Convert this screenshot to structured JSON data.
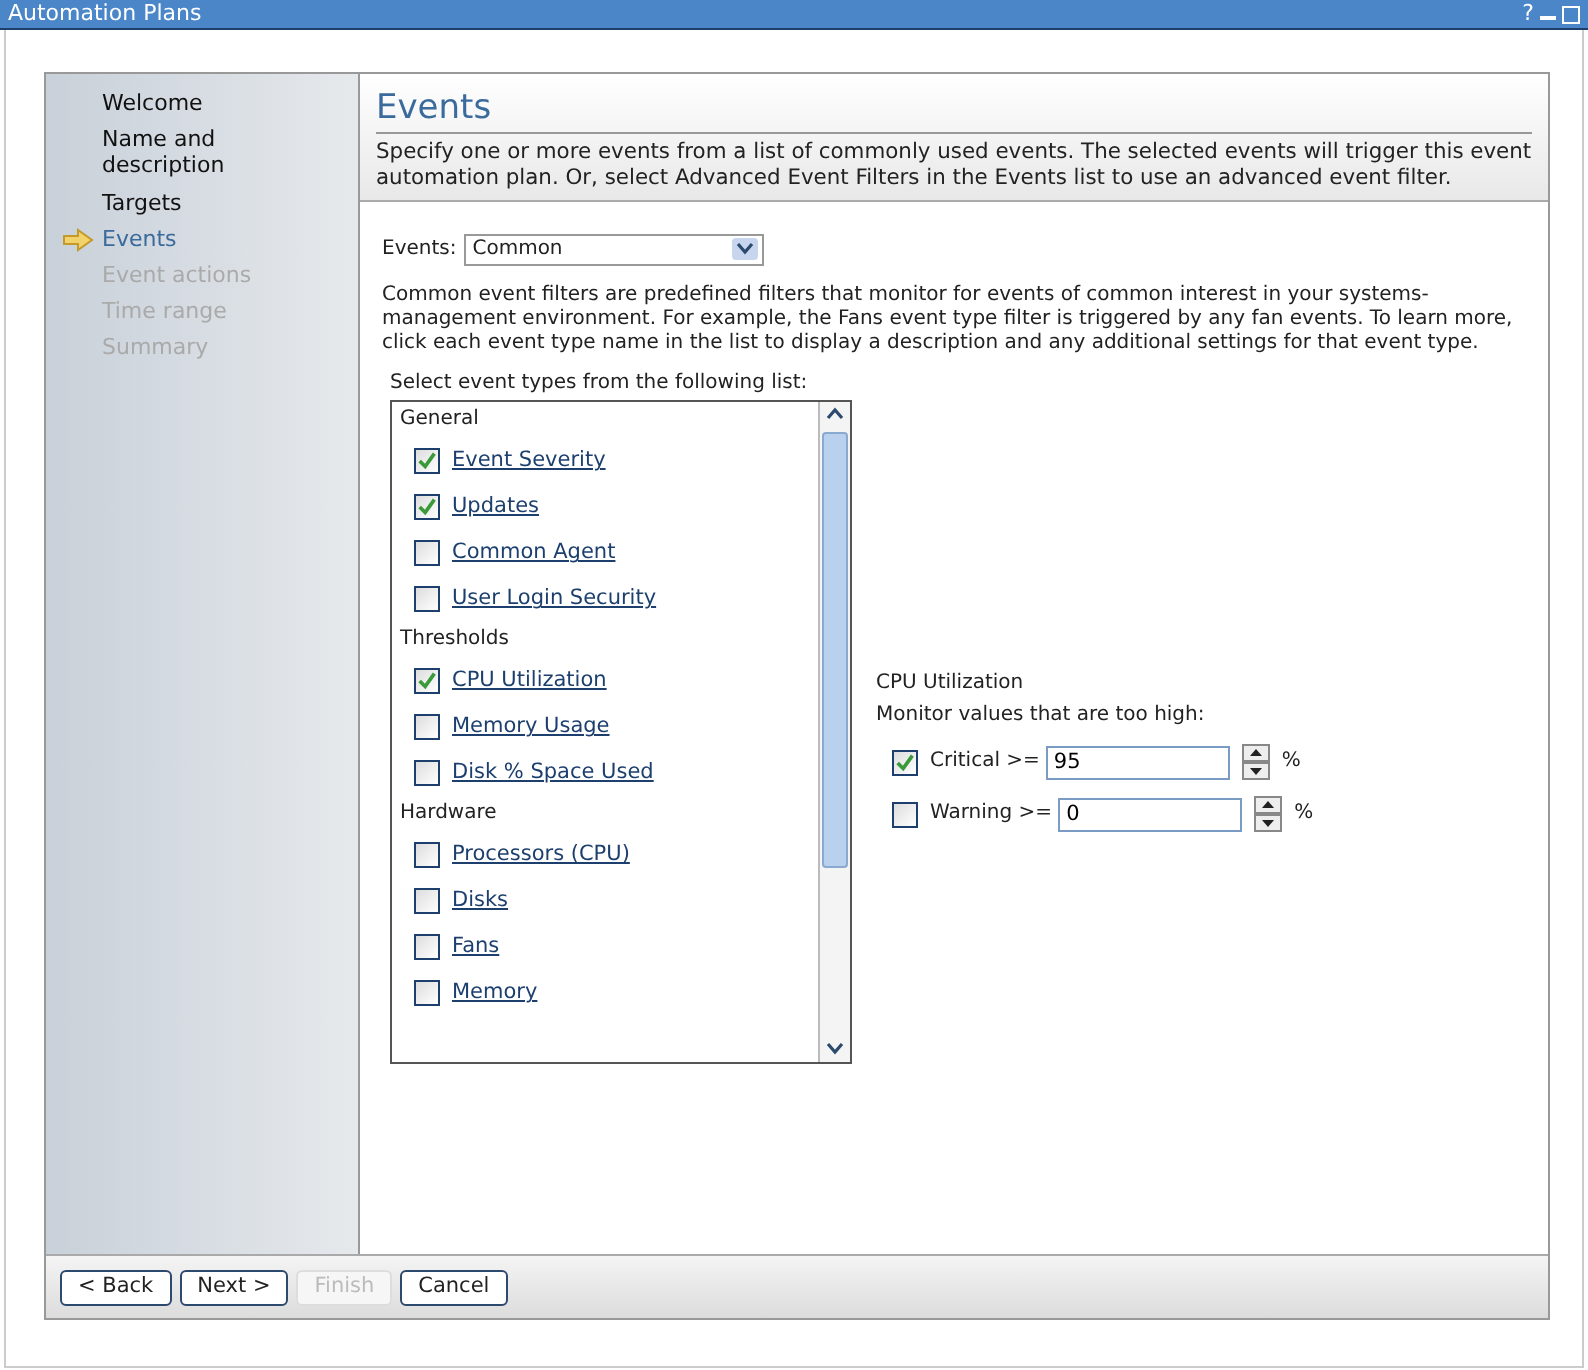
{
  "window": {
    "title": "Automation Plans",
    "help": "?"
  },
  "steps": [
    {
      "label": "Welcome",
      "current": false,
      "disabled": false
    },
    {
      "label": "Name and description",
      "current": false,
      "disabled": false
    },
    {
      "label": "Targets",
      "current": false,
      "disabled": false
    },
    {
      "label": "Events",
      "current": true,
      "disabled": false
    },
    {
      "label": "Event actions",
      "current": false,
      "disabled": true
    },
    {
      "label": "Time range",
      "current": false,
      "disabled": true
    },
    {
      "label": "Summary",
      "current": false,
      "disabled": true
    }
  ],
  "page": {
    "title": "Events",
    "description": "Specify one or more events from a list of commonly used events. The selected events will trigger this event automation plan. Or, select Advanced Event Filters in the Events list to use an advanced event filter."
  },
  "events_select": {
    "label": "Events:",
    "value": "Common"
  },
  "intro": "Common event filters are predefined filters that monitor for events of common interest in your systems-management environment. For example, the Fans event type filter is triggered by any fan events. To learn more, click each event type name in the list to display a description and any additional settings for that event type.",
  "list_label": "Select event types from the following list:",
  "event_groups": [
    {
      "name": "General",
      "items": [
        {
          "label": "Event Severity",
          "checked": true
        },
        {
          "label": "Updates",
          "checked": true
        },
        {
          "label": "Common Agent",
          "checked": false
        },
        {
          "label": "User Login Security",
          "checked": false
        }
      ]
    },
    {
      "name": "Thresholds",
      "items": [
        {
          "label": "CPU Utilization",
          "checked": true
        },
        {
          "label": "Memory Usage",
          "checked": false
        },
        {
          "label": "Disk % Space Used",
          "checked": false
        }
      ]
    },
    {
      "name": "Hardware",
      "items": [
        {
          "label": "Processors (CPU)",
          "checked": false
        },
        {
          "label": "Disks",
          "checked": false
        },
        {
          "label": "Fans",
          "checked": false
        },
        {
          "label": "Memory",
          "checked": false
        }
      ]
    }
  ],
  "detail": {
    "title": "CPU Utilization",
    "subtitle": "Monitor values that are too high:",
    "thresholds": [
      {
        "label": "Critical >=",
        "checked": true,
        "value": "95",
        "unit": "%"
      },
      {
        "label": "Warning >=",
        "checked": false,
        "value": "0",
        "unit": "%"
      }
    ]
  },
  "buttons": [
    {
      "label": "< Back",
      "disabled": false
    },
    {
      "label": "Next >",
      "disabled": false
    },
    {
      "label": "Finish",
      "disabled": true
    },
    {
      "label": "Cancel",
      "disabled": false
    }
  ]
}
